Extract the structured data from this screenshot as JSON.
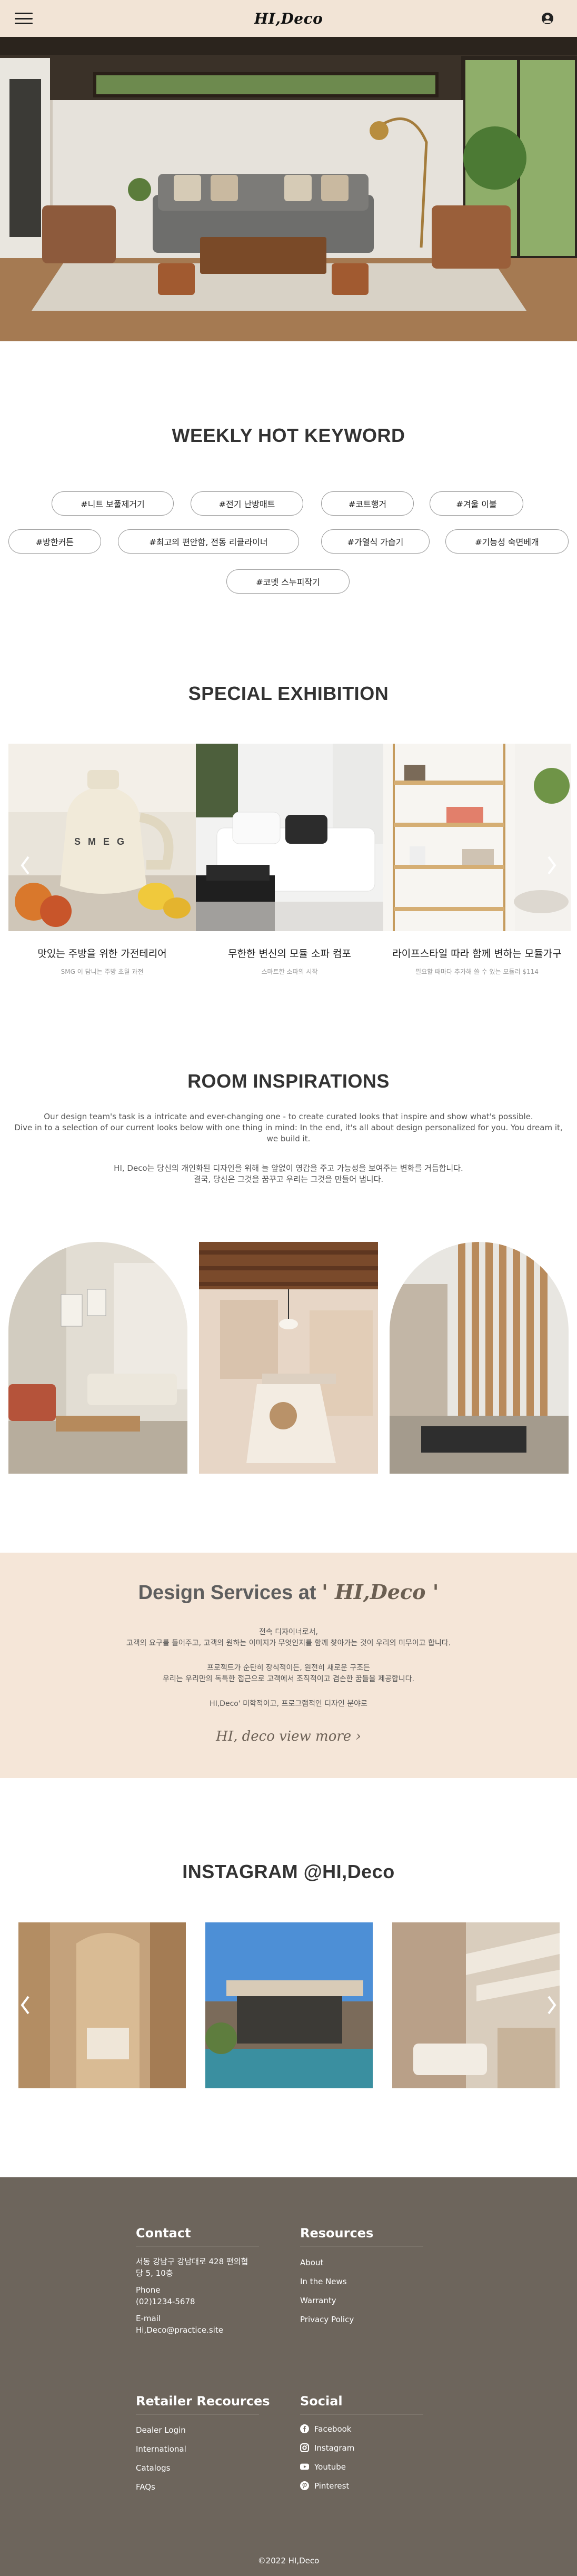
{
  "header": {
    "logo": "HI,Deco",
    "menu_icon": "hamburger-menu-icon",
    "user_icon": "user-circle-icon"
  },
  "keywords": {
    "title": "WEEKLY HOT KEYWORD",
    "items": [
      "#니트 보풀제거기",
      "#전기 난방매트",
      "#코트행거",
      "#겨울 이불",
      "#방한커튼",
      "#최고의 편안함, 전동 리클라이너",
      "#가열식 가습기",
      "#기능성 숙면베개",
      "#코멧 스누피작기"
    ]
  },
  "exhibition": {
    "title": "SPECIAL EXHIBITION",
    "items": [
      {
        "title": "맛있는 주방을 위한 가전테리어",
        "sub": "SMG 이 담니는 주방 초월 과전"
      },
      {
        "title": "무한한 변신의 모듈 소파 컴포",
        "sub": "스마트한 소파의 시작"
      },
      {
        "title": "라이프스타일 따라 함께 변하는 모듈가구",
        "sub": "필요할 때마다 추가해 쓸 수 있는 모듈러 $114"
      }
    ]
  },
  "rooms": {
    "title": "ROOM INSPIRATIONS",
    "en_line1": "Our design team's task is a intricate and ever-changing one - to create curated looks that inspire and show what's possible.",
    "en_line2": "Dive in to a selection of our current looks below with one thing in mind: In the end, it's all about design personalized for you. You dream it,",
    "en_line3": "we build it.",
    "ko_line1": "HI, Deco는 당신의 개인화된 디자인을 위해 늘 앞없이 영감을 주고 가능성을 보여주는 변화를 거듭합니다.",
    "ko_line2": "결국, 당신은 그것을 꿈꾸고 우리는 그것을 만들어 냅니다."
  },
  "design": {
    "title_prefix": "Design Services at ",
    "title_brand": "' HI,Deco '",
    "line1": "전속 디자이너로서,",
    "line2": "고객의 요구를 들어주고, 고객의 원하는 이미지가 무엇인지를 함께 찾아가는 것이 우리의 미무이고 합니다.",
    "line3": "프로젝트가 순탄히 장식적이든, 원전히 새로운 구조든",
    "line4": "우리는 우리만의 독특한 접근으로 고객에서 조직적이고 겸손한 꿈들을 제공합니다.",
    "line5": "HI,Deco' 미학적이고, 프로그램적인 디자인 분야로",
    "view_more": "HI, deco view more ›"
  },
  "instagram": {
    "title": "INSTAGRAM @HI,Deco"
  },
  "footer": {
    "contact": {
      "title": "Contact",
      "address1": "서동 강남구 강남대로 428 편의협",
      "address2": "당 5, 10층",
      "phone_label": "Phone",
      "phone": "(02)1234-5678",
      "email_label": "E-mail",
      "email": "Hi,Deco@practice.site"
    },
    "resources": {
      "title": "Resources",
      "links": [
        "About",
        "In the News",
        "Warranty",
        "Privacy Policy"
      ]
    },
    "retailer": {
      "title": "Retailer Recources",
      "links": [
        "Dealer Login",
        "International",
        "Catalogs",
        "FAQs"
      ]
    },
    "social": {
      "title": "Social",
      "links": [
        "Facebook",
        "Instagram",
        "Youtube",
        "Pinterest"
      ]
    },
    "copyright": "©2022 HI,Deco"
  }
}
